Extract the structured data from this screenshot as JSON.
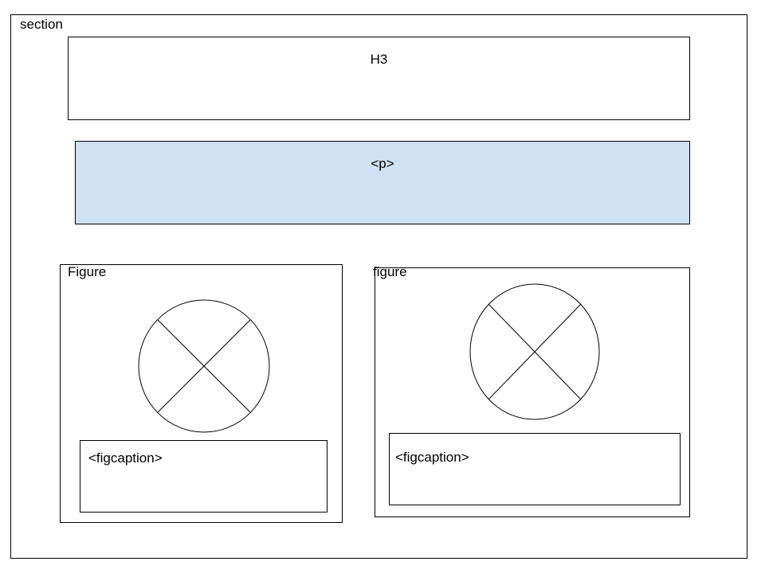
{
  "section": {
    "label": "section",
    "heading_placeholder": "H3",
    "paragraph_placeholder": "<p>",
    "paragraph_fill": "#cfe2f3",
    "figures": [
      {
        "label": "Figure",
        "image_icon": "image-placeholder-icon",
        "caption": "<figcaption>"
      },
      {
        "label": "figure",
        "image_icon": "image-placeholder-icon",
        "caption": "<figcaption>"
      }
    ]
  }
}
